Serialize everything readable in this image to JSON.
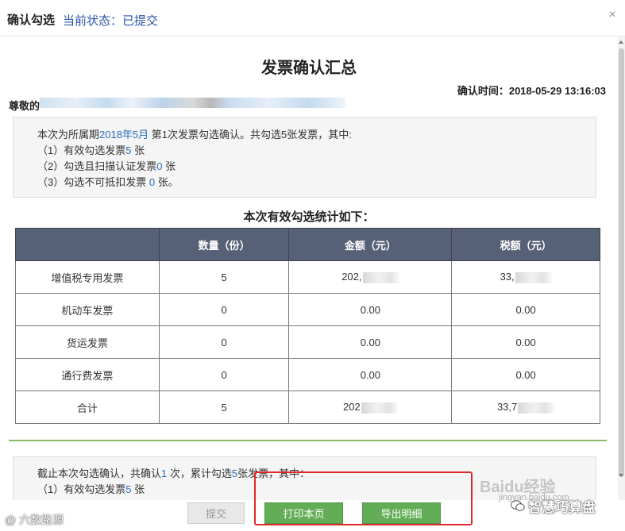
{
  "titlebar": {
    "title": "确认勾选",
    "status": "当前状态：已提交",
    "close_glyph": "×"
  },
  "report": {
    "title": "发票确认汇总",
    "confirm_time": "确认时间：2018-05-29 13:16:03",
    "greeting": "尊敬的"
  },
  "summary_box": {
    "intro_prefix": "本次为所属期",
    "period": "2018年5月",
    "intro_suffix": " 第1次发票勾选确认。共勾选5张发票，其中:",
    "item1_prefix": "（1）有效勾选发票",
    "item1_value": "5",
    "item1_suffix": " 张",
    "item2_prefix": "（2）勾选且扫描认证发票",
    "item2_value": "0",
    "item2_suffix": " 张",
    "item3_prefix": "（3）勾选不可抵扣发票 ",
    "item3_value": "0",
    "item3_suffix": " 张。"
  },
  "stats": {
    "subtitle": "本次有效勾选统计如下：",
    "headers": [
      "",
      "数量（份）",
      "金额（元）",
      "税额（元）"
    ],
    "rows": [
      {
        "name": "增值税专用发票",
        "count": "5",
        "amount": "202,",
        "tax": "33,"
      },
      {
        "name": "机动车发票",
        "count": "0",
        "amount": "0.00",
        "tax": "0.00"
      },
      {
        "name": "货运发票",
        "count": "0",
        "amount": "0.00",
        "tax": "0.00"
      },
      {
        "name": "通行费发票",
        "count": "0",
        "amount": "0.00",
        "tax": "0.00"
      },
      {
        "name": "合计",
        "count": "5",
        "amount": "202",
        "tax": "33,7"
      }
    ]
  },
  "cumulative_box": {
    "line1_prefix": "截止本次勾选确认，共确认",
    "confirm_count": "1",
    "line1_middle": " 次，累计勾选",
    "total_count": "5",
    "line1_suffix": "张发票，其中：",
    "item1_prefix": "（1）有效勾选发票",
    "item1_value": "5",
    "item1_suffix": " 张"
  },
  "footer": {
    "submit_label": "提交",
    "print_label": "打印本页",
    "export_label": "导出明细"
  },
  "watermarks": {
    "left": "@ 六数路源",
    "baidu": "Baidu经验",
    "baidu_sub": "jingyan.baidu.com",
    "right": "智慧巧算盘"
  },
  "colors": {
    "header_bg": "#566177",
    "accent_blue": "#2a6fbb",
    "button_green": "#62ad55",
    "highlight_red": "#e02828",
    "divider_green": "#8cba64"
  }
}
